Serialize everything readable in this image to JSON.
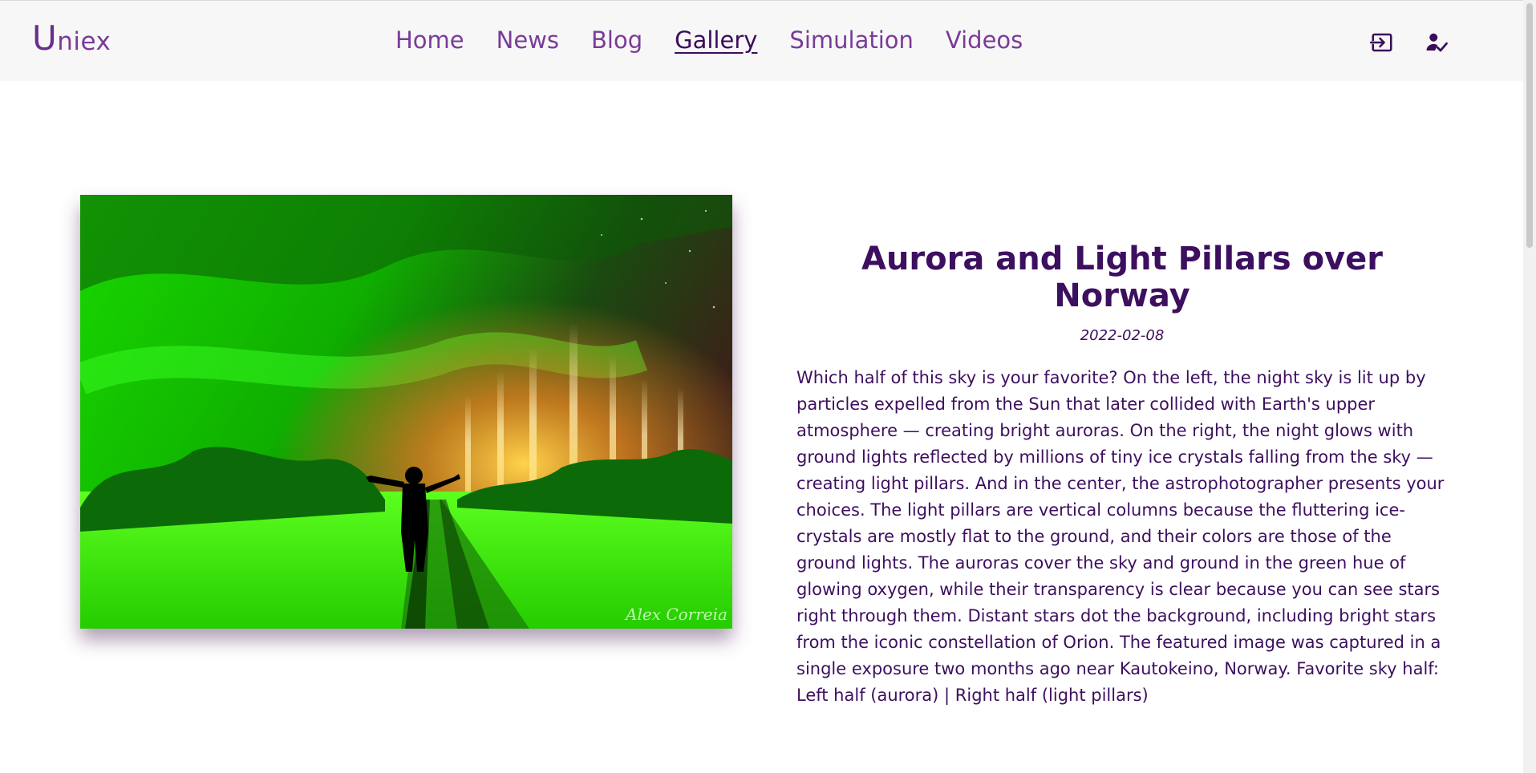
{
  "header": {
    "logo_cap": "U",
    "logo_rest": "niex",
    "nav": [
      {
        "label": "Home"
      },
      {
        "label": "News"
      },
      {
        "label": "Blog"
      },
      {
        "label": "Gallery"
      },
      {
        "label": "Simulation"
      },
      {
        "label": "Videos"
      }
    ],
    "active_nav": "Gallery",
    "icons": [
      "login-icon",
      "user-check-icon"
    ]
  },
  "article": {
    "title": "Aurora and Light Pillars over Norway",
    "date": "2022-02-08",
    "description": "Which half of this sky is your favorite? On the left, the night sky is lit up by particles expelled from the Sun that later collided with Earth's upper atmosphere — creating bright auroras. On the right, the night glows with ground lights reflected by millions of tiny ice crystals falling from the sky — creating light pillars. And in the center, the astrophotographer presents your choices. The light pillars are vertical columns because the fluttering ice-crystals are mostly flat to the ground, and their colors are those of the ground lights. The auroras cover the sky and ground in the green hue of glowing oxygen, while their transparency is clear because you can see stars right through them. Distant stars dot the background, including bright stars from the iconic constellation of Orion. The featured image was captured in a single exposure two months ago near Kautokeino, Norway. Favorite sky half: Left half (aurora) | Right half (light pillars)",
    "image_watermark": "Alex Correia"
  },
  "colors": {
    "nav_text": "#7a3b98",
    "nav_active": "#3a0c5a",
    "body_text": "#3d0f5f",
    "navbar_bg": "#f7f7f7"
  }
}
